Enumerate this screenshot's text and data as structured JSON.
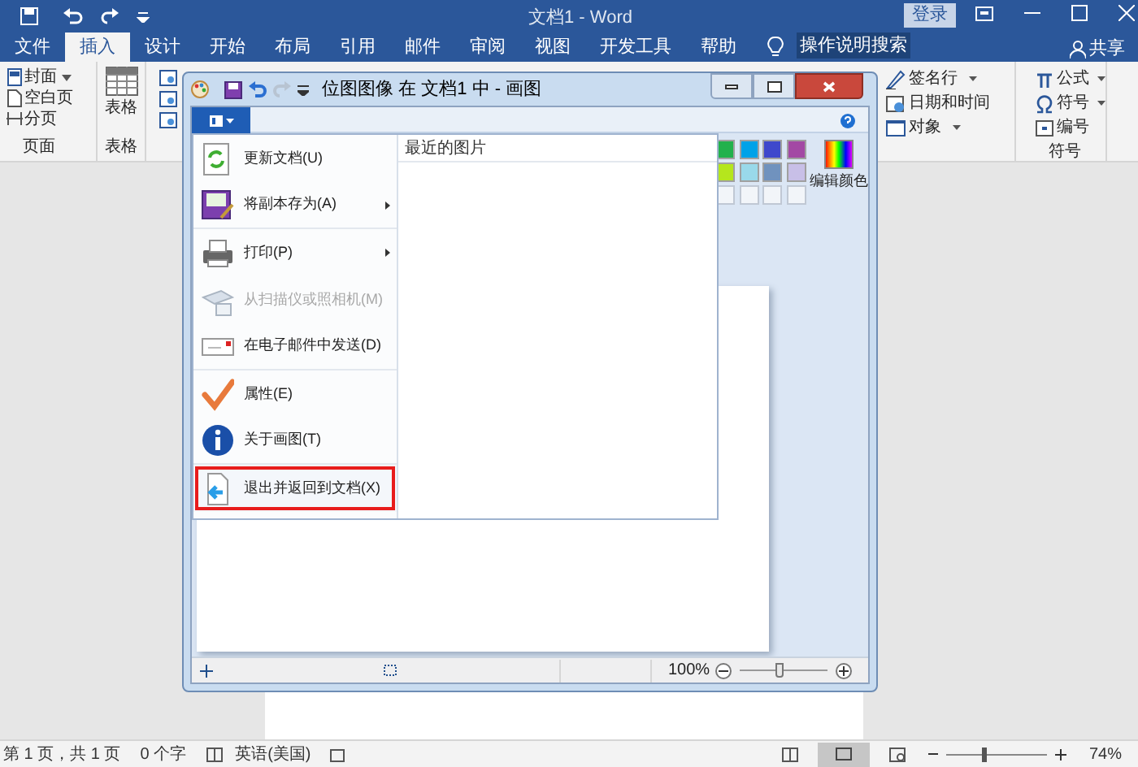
{
  "word": {
    "title": "文档1  -  Word",
    "signin": "登录",
    "share": "共享",
    "search": "操作说明搜索",
    "tabs": [
      {
        "label": "文件",
        "selected": false
      },
      {
        "label": "插入",
        "selected": true
      },
      {
        "label": "设计",
        "selected": false
      },
      {
        "label": "开始",
        "selected": false
      },
      {
        "label": "布局",
        "selected": false
      },
      {
        "label": "引用",
        "selected": false
      },
      {
        "label": "邮件",
        "selected": false
      },
      {
        "label": "审阅",
        "selected": false
      },
      {
        "label": "视图",
        "selected": false
      },
      {
        "label": "开发工具",
        "selected": false
      },
      {
        "label": "帮助",
        "selected": false
      }
    ],
    "pages_group": {
      "items": [
        "封面",
        "空白页",
        "分页"
      ],
      "label": "页面"
    },
    "table_group": {
      "button": "表格",
      "label": "表格"
    },
    "text_items": [
      "签名行",
      "日期和时间",
      "对象"
    ],
    "symbol_group": {
      "items": [
        "公式",
        "符号",
        "编号"
      ],
      "label": "符号"
    },
    "status_bar": {
      "page": "第 1 页，共 1 页",
      "words": "0 个字",
      "language": "英语(美国)",
      "zoom": "74%",
      "zoom_slider": {
        "level": 0.37
      }
    }
  },
  "paint": {
    "title": "位图图像 在 文档1 中 - 画图",
    "menu": [
      {
        "label": "更新文档(U)",
        "submenu": false,
        "disabled": false,
        "selected": false
      },
      {
        "label": "将副本存为(A)",
        "submenu": true,
        "disabled": false,
        "selected": false
      },
      {
        "label": "打印(P)",
        "submenu": true,
        "disabled": false,
        "selected": false
      },
      {
        "label": "从扫描仪或照相机(M)",
        "submenu": false,
        "disabled": true,
        "selected": false
      },
      {
        "label": "在电子邮件中发送(D)",
        "submenu": false,
        "disabled": false,
        "selected": false
      },
      {
        "label": "属性(E)",
        "submenu": false,
        "disabled": false,
        "selected": false
      },
      {
        "label": "关于画图(T)",
        "submenu": false,
        "disabled": false,
        "selected": false
      },
      {
        "label": "退出并返回到文档(X)",
        "submenu": false,
        "disabled": false,
        "selected": true
      }
    ],
    "recent_heading": "最近的图片",
    "colors": [
      {
        "color": "#22b14c"
      },
      {
        "color": "#00a2e8"
      },
      {
        "color": "#3f48cc"
      },
      {
        "color": "#a349a4"
      },
      {
        "color": "#b5e61d"
      },
      {
        "color": "#99d9ea"
      },
      {
        "color": "#7092be"
      },
      {
        "color": "#c8bfe7"
      }
    ],
    "edit_colors": "编辑颜色",
    "zoom": "100%",
    "zoom_slider": {
      "level": 0.45
    }
  }
}
